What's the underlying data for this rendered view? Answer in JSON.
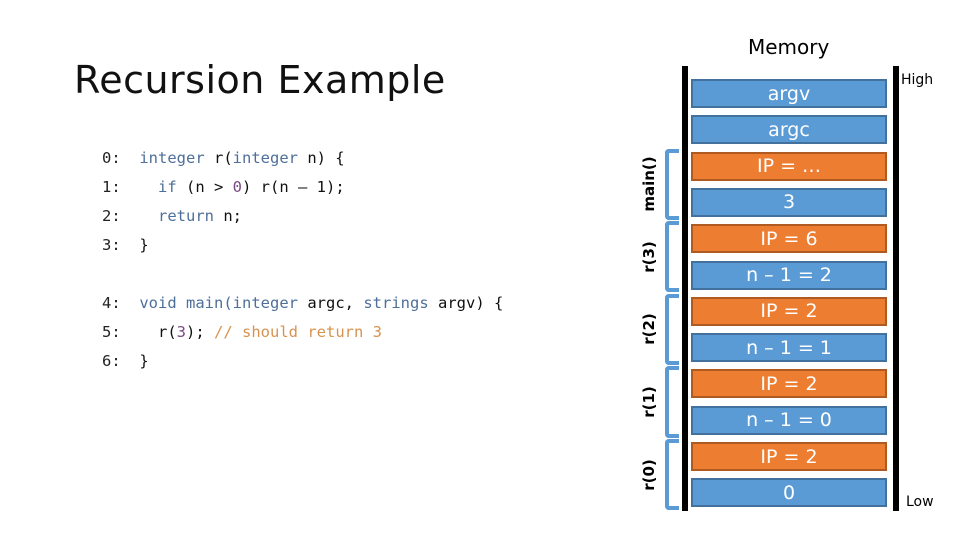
{
  "title": "Recursion Example",
  "code": {
    "lines": [
      {
        "num": "0:",
        "parts": [
          {
            "t": "integer",
            "c": "kw"
          },
          {
            "t": " r(",
            "c": ""
          },
          {
            "t": "integer",
            "c": "kw"
          },
          {
            "t": " n) {",
            "c": ""
          }
        ]
      },
      {
        "num": "1:",
        "parts": [
          {
            "t": "  ",
            "c": ""
          },
          {
            "t": "if",
            "c": "kw"
          },
          {
            "t": " (n > ",
            "c": ""
          },
          {
            "t": "0",
            "c": "num"
          },
          {
            "t": ") r(n – 1);",
            "c": ""
          }
        ]
      },
      {
        "num": "2:",
        "parts": [
          {
            "t": "  ",
            "c": ""
          },
          {
            "t": "return",
            "c": "kw"
          },
          {
            "t": " n;",
            "c": ""
          }
        ]
      },
      {
        "num": "3:",
        "parts": [
          {
            "t": "}",
            "c": ""
          }
        ]
      },
      {
        "num": "4:",
        "parts": [
          {
            "t": "void",
            "c": "kw"
          },
          {
            "t": " ",
            "c": ""
          },
          {
            "t": "main(",
            "c": "kw"
          },
          {
            "t": "integer",
            "c": "kw"
          },
          {
            "t": " argc, ",
            "c": ""
          },
          {
            "t": "strings",
            "c": "kw"
          },
          {
            "t": " argv) {",
            "c": ""
          }
        ]
      },
      {
        "num": "5:",
        "parts": [
          {
            "t": "  r(",
            "c": ""
          },
          {
            "t": "3",
            "c": "num"
          },
          {
            "t": "); ",
            "c": ""
          },
          {
            "t": "// should return 3",
            "c": "cm"
          }
        ]
      },
      {
        "num": "6:",
        "parts": [
          {
            "t": "}",
            "c": ""
          }
        ]
      }
    ]
  },
  "memory": {
    "title": "Memory",
    "high_label": "High",
    "low_label": "Low",
    "cells": [
      {
        "label": "argv",
        "kind": "value"
      },
      {
        "label": "argc",
        "kind": "value"
      },
      {
        "label": "IP = …",
        "kind": "ip"
      },
      {
        "label": "3",
        "kind": "value"
      },
      {
        "label": "IP = 6",
        "kind": "ip"
      },
      {
        "label": "n – 1 = 2",
        "kind": "value"
      },
      {
        "label": "IP = 2",
        "kind": "ip"
      },
      {
        "label": "n – 1 = 1",
        "kind": "value"
      },
      {
        "label": "IP = 2",
        "kind": "ip"
      },
      {
        "label": "n – 1 = 0",
        "kind": "value"
      },
      {
        "label": "IP = 2",
        "kind": "ip"
      },
      {
        "label": "0",
        "kind": "value"
      }
    ],
    "frames": [
      {
        "label": "main()",
        "first_cell": 2,
        "last_cell": 3
      },
      {
        "label": "r(3)",
        "first_cell": 4,
        "last_cell": 5
      },
      {
        "label": "r(2)",
        "first_cell": 6,
        "last_cell": 7
      },
      {
        "label": "r(1)",
        "first_cell": 8,
        "last_cell": 9
      },
      {
        "label": "r(0)",
        "first_cell": 10,
        "last_cell": 11
      }
    ]
  },
  "colors": {
    "value_cell": "#5b9bd5",
    "ip_cell": "#ed7d31",
    "bracket": "#5b9bd5",
    "keyword": "#4e6f9a",
    "comment": "#d8924f"
  }
}
